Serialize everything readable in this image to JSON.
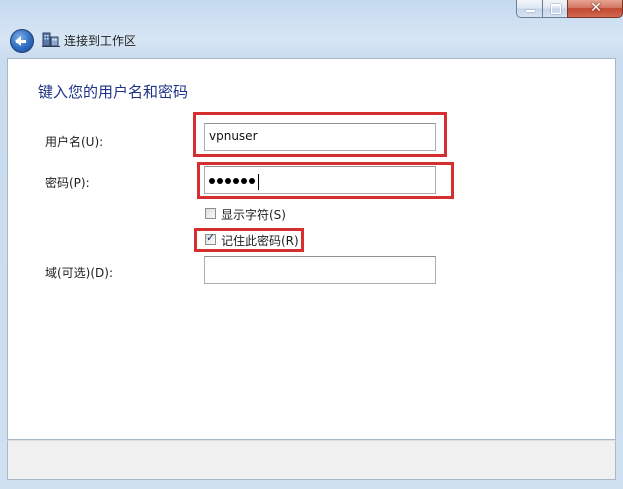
{
  "window": {
    "controls": {
      "minimize_icon": "minimize-icon",
      "maximize_icon": "maximize-icon",
      "close_label": "✕"
    }
  },
  "nav": {
    "title": "连接到工作区"
  },
  "form": {
    "heading": "键入您的用户名和密码",
    "username": {
      "label": "用户名(U):",
      "value": "vpnuser"
    },
    "password": {
      "label": "密码(P):",
      "masked_length": 6
    },
    "show_chars": {
      "label": "显示字符(S)",
      "checked": false
    },
    "remember": {
      "label": "记住此密码(R)",
      "checked": true
    },
    "domain": {
      "label": "域(可选)(D):",
      "value": ""
    }
  },
  "colors": {
    "highlight": "#d62f2f",
    "heading": "#1e3287"
  }
}
